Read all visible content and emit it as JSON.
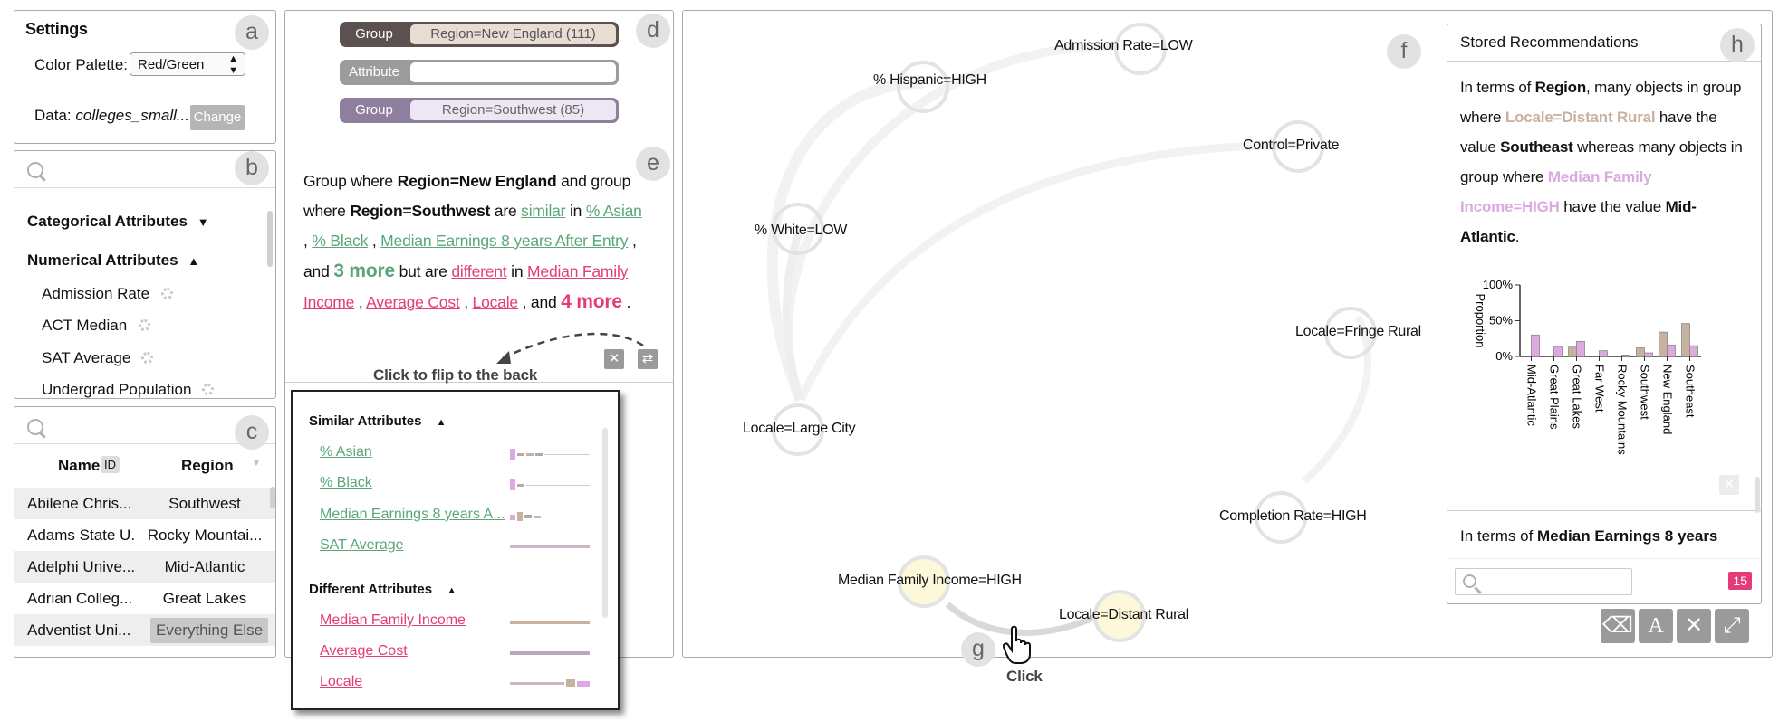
{
  "settings": {
    "title": "Settings",
    "palette_label": "Color Palette:",
    "palette_value": "Red/Green",
    "data_label": "Data:",
    "data_value": "colleges_small...",
    "change_button": "Change"
  },
  "attributes": {
    "categorical_label": "Categorical Attributes",
    "numerical_label": "Numerical Attributes",
    "items": [
      "Admission Rate",
      "ACT Median",
      "SAT Average",
      "Undergrad Population"
    ]
  },
  "table": {
    "col_name": "Name",
    "id_badge": "ID",
    "col_region": "Region",
    "rows": [
      {
        "name": "Abilene Chris...",
        "region": "Southwest"
      },
      {
        "name": "Adams State U...",
        "region": "Rocky Mountai..."
      },
      {
        "name": "Adelphi Unive...",
        "region": "Mid-Atlantic"
      },
      {
        "name": "Adrian Colleg...",
        "region": "Great Lakes"
      },
      {
        "name": "Adventist Uni...",
        "region": "Everything Else"
      }
    ]
  },
  "comparison": {
    "group1_label": "Group",
    "group1_value": "Region=New England (111)",
    "attr_label": "Attribute",
    "attr_value": "",
    "group2_label": "Group",
    "group2_value": "Region=Southwest (85)"
  },
  "summary": {
    "t1": "Group where ",
    "g1": "Region=New England",
    "t2": " and group where ",
    "g2": "Region=Southwest",
    "t3": " are ",
    "similar": "similar",
    "t4": " in ",
    "s1": "% Asian",
    "sep": " , ",
    "s2": "% Black",
    "s3": "Median Earnings 8 years After Entry",
    "and1": " , and ",
    "more_sim": "3 more",
    "but": " but are ",
    "different": "different",
    "in2": " in ",
    "d1": "Median Family Income",
    "d2": "Average Cost",
    "d3": "Locale",
    "and2": " , and ",
    "more_dif": "4 more",
    "end": " ."
  },
  "back_card": {
    "caption": "Click to flip to the back",
    "similar_header": "Similar Attributes",
    "similar": [
      "% Asian",
      "% Black",
      "Median Earnings 8 years A...",
      "SAT Average"
    ],
    "different_header": "Different Attributes",
    "different": [
      "Median Family Income",
      "Average Cost",
      "Locale"
    ]
  },
  "graph": {
    "nodes": [
      "Admission Rate=LOW",
      "% Hispanic=HIGH",
      "Control=Private",
      "% White=LOW",
      "Locale=Fringe Rural",
      "Locale=Large City",
      "Completion Rate=HIGH",
      "Median Family Income=HIGH",
      "Locale=Distant Rural"
    ],
    "click_caption": "Click"
  },
  "stored": {
    "title": "Stored Recommendations",
    "r1_a": "In terms of ",
    "r1_attr": "Region",
    "r1_b": ", many objects in group where ",
    "r1_g1": "Locale=Distant Rural",
    "r1_c": " have the value ",
    "r1_v1": "Southeast",
    "r1_d": " whereas many objects in group where ",
    "r1_g2": "Median Family Income=HIGH",
    "r1_e": " have the value ",
    "r1_v2": "Mid-Atlantic",
    "r1_f": ".",
    "r2_a": "In terms of ",
    "r2_attr": "Median Earnings 8 years",
    "count": "15",
    "colors": {
      "group1": "#c9b1a0",
      "group2": "#dca9e0"
    }
  },
  "chart_data": {
    "type": "bar",
    "ylabel": "Proportion",
    "yticks": [
      "100%",
      "50%",
      "0%"
    ],
    "ylim": [
      0,
      1
    ],
    "categories": [
      "Mid-Atlantic",
      "Great Plains",
      "Great Lakes",
      "Far West",
      "Rocky Mountains",
      "Southwest",
      "New England",
      "Southeast"
    ],
    "series": [
      {
        "values": [
          0.0,
          0.0,
          0.13,
          0.0,
          0.0,
          0.12,
          0.34,
          0.46
        ]
      },
      {
        "values": [
          0.3,
          0.14,
          0.21,
          0.08,
          0.02,
          0.05,
          0.16,
          0.15
        ]
      }
    ]
  },
  "labels": {
    "a": "a",
    "b": "b",
    "c": "c",
    "d": "d",
    "e": "e",
    "f": "f",
    "g": "g",
    "h": "h"
  }
}
